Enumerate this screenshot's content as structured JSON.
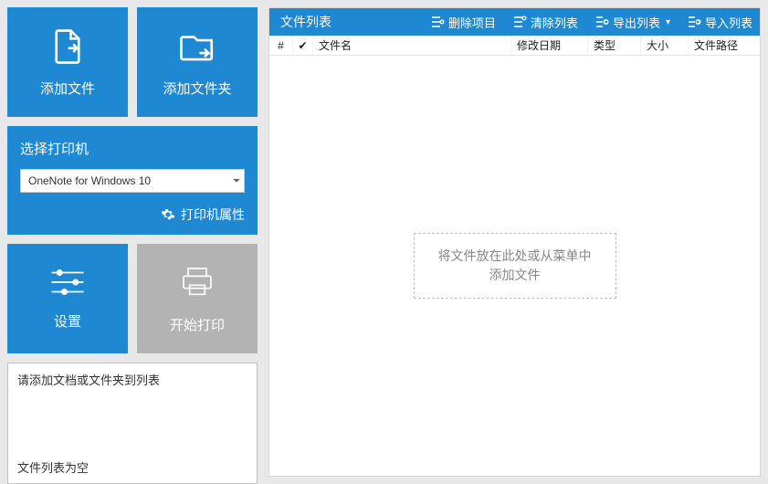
{
  "tiles": {
    "add_file": "添加文件",
    "add_folder": "添加文件夹"
  },
  "printer_panel": {
    "title": "选择打印机",
    "selected": "OneNote for Windows 10",
    "props": "打印机属性"
  },
  "actions": {
    "settings": "设置",
    "start_print": "开始打印"
  },
  "status": {
    "line1": "请添加文档或文件夹到列表",
    "line2": "文件列表为空"
  },
  "right": {
    "title": "文件列表",
    "buttons": {
      "delete": "删除项目",
      "clear": "清除列表",
      "export": "导出列表",
      "import": "导入列表"
    },
    "columns": {
      "num": "#",
      "name": "文件名",
      "date": "修改日期",
      "type": "类型",
      "size": "大小",
      "path": "文件路径"
    },
    "drop_line1": "将文件放在此处或从菜单中",
    "drop_line2": "添加文件"
  }
}
